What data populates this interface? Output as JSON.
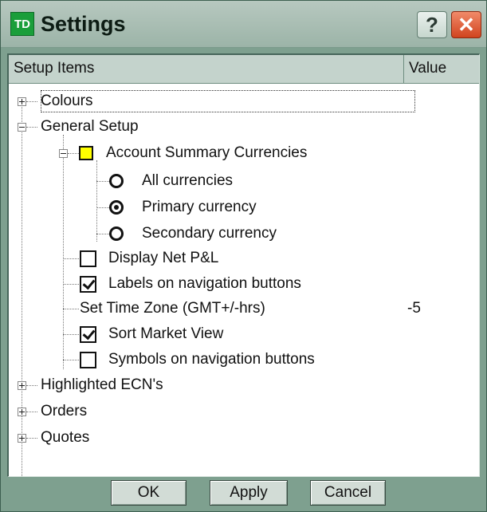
{
  "window": {
    "title": "Settings",
    "logo_text": "TD",
    "help_label": "?",
    "close_label": "✕"
  },
  "columns": {
    "items_header": "Setup Items",
    "value_header": "Value"
  },
  "tree": {
    "colours": "Colours",
    "general_setup": "General Setup",
    "account_summary_currencies": "Account Summary Currencies",
    "all_currencies": "All currencies",
    "primary_currency": "Primary currency",
    "secondary_currency": "Secondary currency",
    "display_net_pl": "Display Net P&L",
    "labels_on_nav": "Labels on navigation buttons",
    "set_time_zone": "Set Time Zone (GMT+/-hrs)",
    "set_time_zone_value": "-5",
    "sort_market_view": "Sort Market View",
    "symbols_on_nav": "Symbols on navigation buttons",
    "highlighted_ecns": "Highlighted ECN's",
    "orders": "Orders",
    "quotes": "Quotes"
  },
  "state": {
    "currency_selected": "Primary currency",
    "display_net_pl_checked": false,
    "labels_on_nav_checked": true,
    "sort_market_view_checked": true,
    "symbols_on_nav_checked": false
  },
  "buttons": {
    "ok": "OK",
    "apply": "Apply",
    "cancel": "Cancel"
  },
  "colors": {
    "accent_folder": "#ffff00",
    "frame": "#7ea08f"
  }
}
